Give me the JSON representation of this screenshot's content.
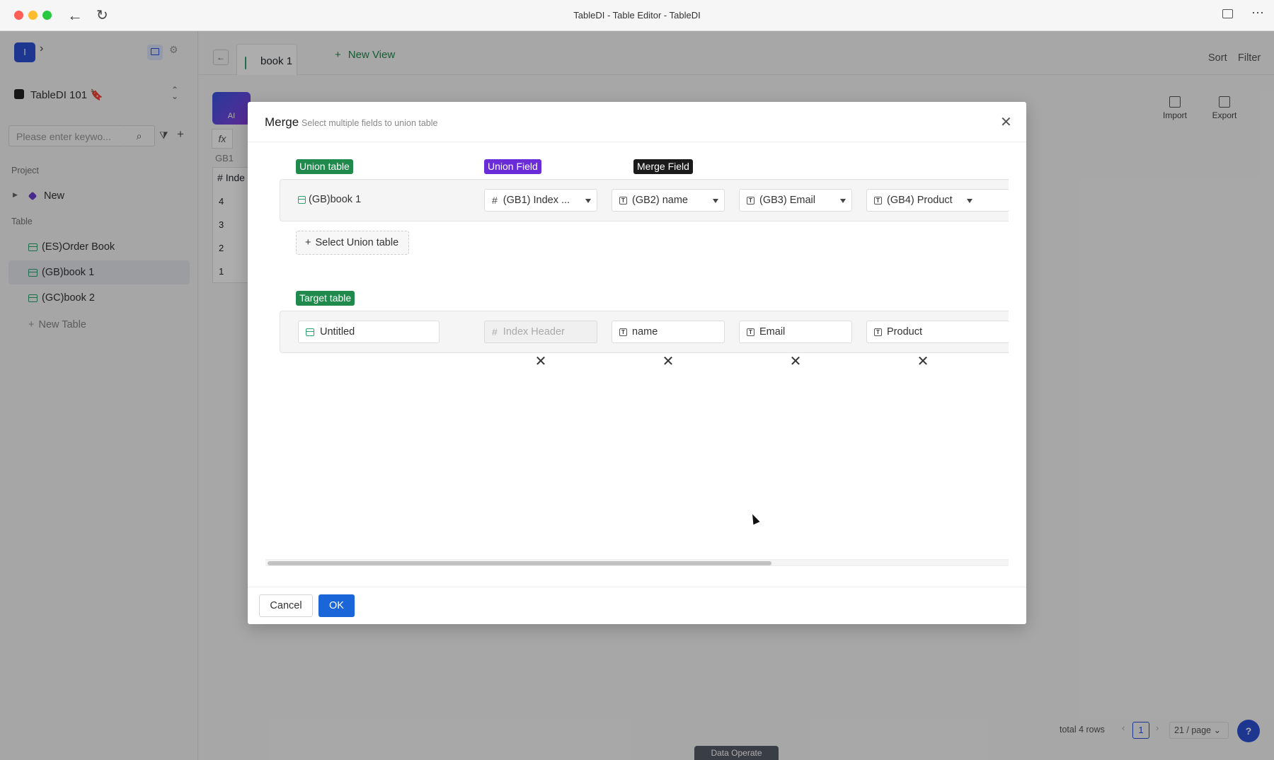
{
  "window": {
    "title": "TableDI - Table Editor - TableDI"
  },
  "sidebar": {
    "workspace_initial": "I",
    "project_name": "TableDI 101 🔖",
    "search_placeholder": "Please enter keywo...",
    "section_project": "Project",
    "project_item": "New",
    "section_table": "Table",
    "tables": [
      {
        "label": "(ES)Order Book"
      },
      {
        "label": "(GB)book 1"
      },
      {
        "label": "(GC)book 2"
      }
    ],
    "new_table": "New Table"
  },
  "tabs": {
    "active_tab": "book 1",
    "new_view": "New View",
    "sort": "Sort",
    "filter": "Filter"
  },
  "toolbar": {
    "ai_label": "AI",
    "import": "Import",
    "export": "Export"
  },
  "grid": {
    "ref": "GB1",
    "header": "Inde",
    "rows": [
      "4",
      "3",
      "2",
      "1"
    ]
  },
  "footer": {
    "total": "total 4 rows",
    "page": "1",
    "per_page": "21 / page",
    "data_operate": "Data Operate"
  },
  "modal": {
    "title": "Merge",
    "subtitle": "Select multiple fields to union table",
    "union_table_tag": "Union table",
    "union_field_tag": "Union Field",
    "merge_field_tag": "Merge Field",
    "union_table_value": "(GB)book 1",
    "union_fields": [
      "(GB1) Index ...",
      "(GB2) name",
      "(GB3) Email",
      "(GB4) Product"
    ],
    "select_union_table": "Select Union table",
    "target_table_tag": "Target table",
    "target_table_value": "Untitled",
    "target_fields": [
      "Index Header",
      "name",
      "Email",
      "Product"
    ],
    "cancel": "Cancel",
    "ok": "OK",
    "colors": {
      "union_table": "#1f8a4c",
      "union_field": "#6a2bd8",
      "merge_field": "#1a1a1a",
      "target_table": "#1f8a4c",
      "primary": "#1a66d8"
    }
  }
}
